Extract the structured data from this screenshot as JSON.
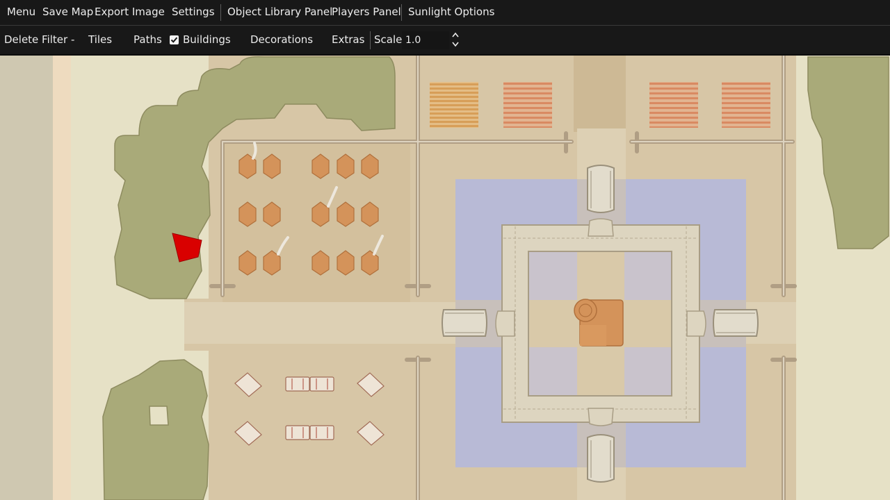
{
  "menu_bar": {
    "items": [
      "Menu",
      "Save Map",
      "Export Image",
      "Settings",
      "Object Library Panel",
      "Players Panel",
      "Sunlight Options"
    ]
  },
  "filter_bar": {
    "delete_filter_label": "Delete Filter -",
    "filters": [
      {
        "label": "Tiles",
        "checked": false
      },
      {
        "label": "Paths",
        "checked": false
      },
      {
        "label": "Buildings",
        "checked": true
      },
      {
        "label": "Decorations",
        "checked": false
      },
      {
        "label": "Extras",
        "checked": false
      }
    ],
    "scale_label": "Scale",
    "scale_value": "1.0"
  },
  "map": {
    "colors": {
      "parchment": "#e6e1c6",
      "ground": "#d7c6a6",
      "water": "#b8bad6",
      "stone_wall": "#ddd5c0",
      "building": "#d4935a",
      "tree": "#a9aa79",
      "selection_marker": "#d90000"
    },
    "icons": [
      "tree-cluster",
      "fence",
      "tent",
      "gate-tower",
      "crop-field",
      "selection-marker"
    ]
  }
}
